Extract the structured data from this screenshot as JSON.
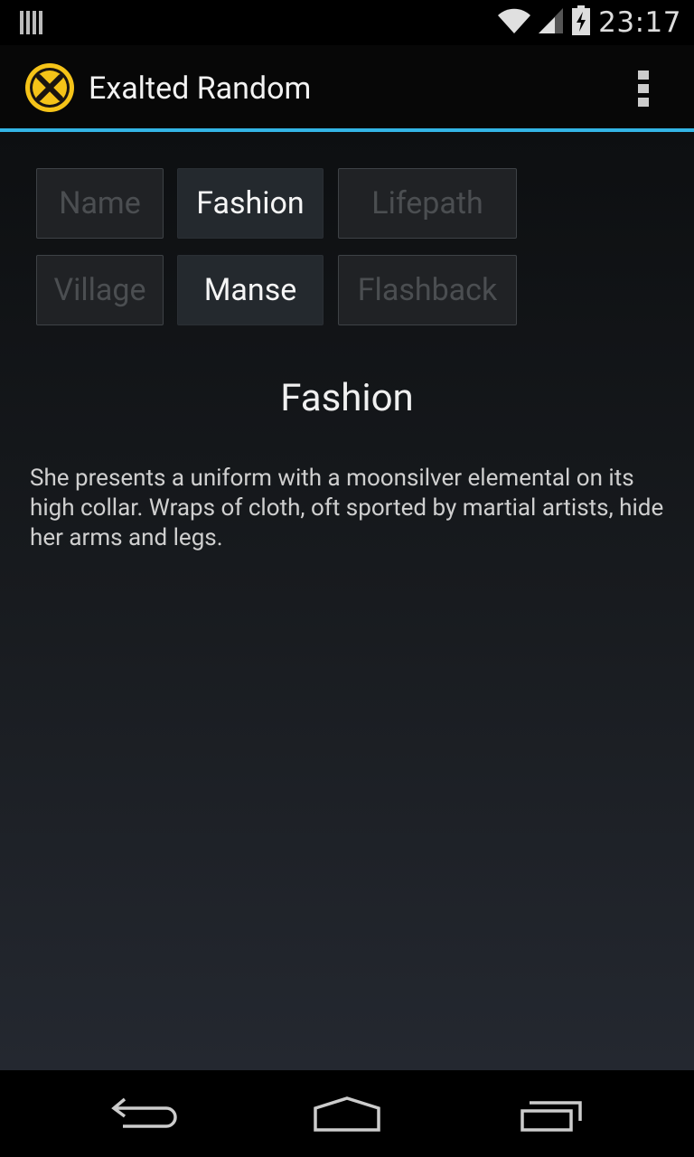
{
  "status_bar": {
    "time": "23:17",
    "icons": [
      "notification-bars-icon",
      "wifi-icon",
      "signal-icon",
      "battery-charging-icon"
    ]
  },
  "action_bar": {
    "title": "Exalted Random",
    "app_icon": "exalted-logo-icon",
    "overflow_icon": "overflow-menu-icon",
    "accent_color": "#33b5e5",
    "logo_color": "#f5c318"
  },
  "buttons": [
    {
      "label": "Name",
      "active": false
    },
    {
      "label": "Fashion",
      "active": true
    },
    {
      "label": "Lifepath",
      "active": false
    },
    {
      "label": "Village",
      "active": false
    },
    {
      "label": "Manse",
      "active": true
    },
    {
      "label": "Flashback",
      "active": false
    }
  ],
  "main": {
    "title": "Fashion",
    "description": "She presents a uniform with a moonsilver elemental on its high collar. Wraps of cloth, oft sported by martial artists, hide her arms and legs."
  },
  "nav_bar": {
    "icons": [
      "back-icon",
      "home-icon",
      "recent-apps-icon"
    ]
  }
}
